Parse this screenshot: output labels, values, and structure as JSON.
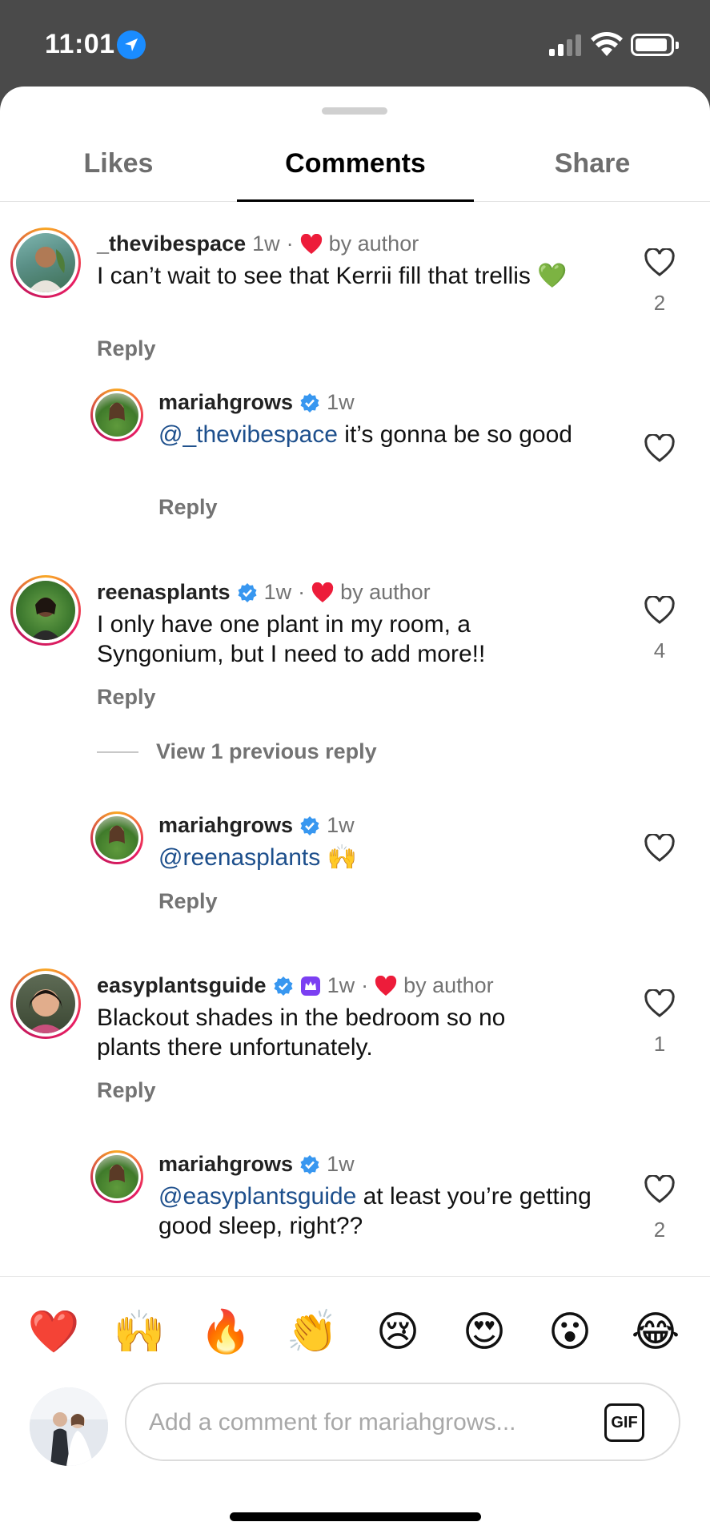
{
  "status_bar": {
    "time": "11:01"
  },
  "tabs": [
    {
      "label": "Likes"
    },
    {
      "label": "Comments"
    },
    {
      "label": "Share"
    }
  ],
  "comments": [
    {
      "username": "_thevibespace",
      "time": "1w",
      "sep": "·",
      "by_author": "by author",
      "text": "I can’t wait to see that Kerrii fill that trellis 💚",
      "reply": "Reply",
      "likes": "2"
    },
    {
      "username": "mariahgrows",
      "time": "1w",
      "mention": "@_thevibespace",
      "text": " it’s gonna be so good",
      "reply": "Reply"
    },
    {
      "username": "reenasplants",
      "time": "1w",
      "sep": "·",
      "by_author": "by author",
      "text": "I only have one plant in my room, a Syngonium, but I need to add more!!",
      "reply": "Reply",
      "likes": "4"
    },
    {
      "view_previous": "View 1 previous reply"
    },
    {
      "username": "mariahgrows",
      "time": "1w",
      "mention": "@reenasplants",
      "text": " 🙌",
      "reply": "Reply"
    },
    {
      "username": "easyplantsguide",
      "time": "1w",
      "sep": "·",
      "by_author": "by author",
      "text": "Blackout shades in the bedroom so no plants there unfortunately.",
      "reply": "Reply",
      "likes": "1"
    },
    {
      "username": "mariahgrows",
      "time": "1w",
      "mention": "@easyplantsguide",
      "text": " at least you’re getting good sleep, right??",
      "likes": "2"
    }
  ],
  "emoji_bar": [
    "❤️",
    "🙌",
    "🔥",
    "👏",
    "😢",
    "😍",
    "😮",
    "😂"
  ],
  "composer": {
    "placeholder": "Add a comment for mariahgrows...",
    "gif_label": "GIF"
  },
  "colors": {
    "accent_blue": "#1a8cff",
    "mention": "#1d4f8c",
    "heart_red": "#ed1c3a"
  }
}
